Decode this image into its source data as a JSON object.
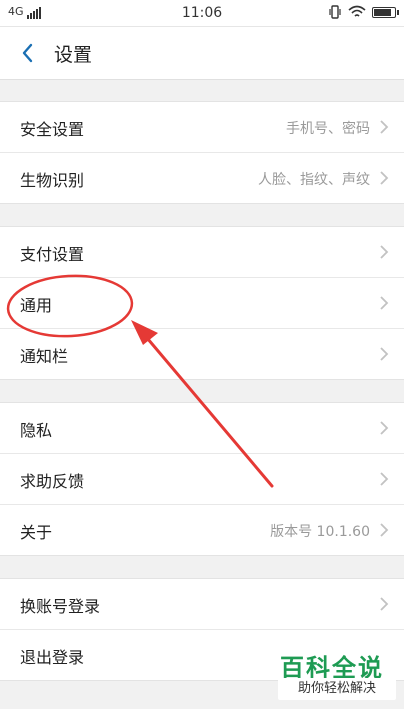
{
  "status_bar": {
    "network": "4G",
    "time": "11:06"
  },
  "header": {
    "title": "设置"
  },
  "groups": [
    {
      "items": [
        {
          "label": "安全设置",
          "value": "手机号、密码"
        },
        {
          "label": "生物识别",
          "value": "人脸、指纹、声纹"
        }
      ]
    },
    {
      "items": [
        {
          "label": "支付设置",
          "value": ""
        },
        {
          "label": "通用",
          "value": ""
        },
        {
          "label": "通知栏",
          "value": ""
        }
      ]
    },
    {
      "items": [
        {
          "label": "隐私",
          "value": ""
        },
        {
          "label": "求助反馈",
          "value": ""
        },
        {
          "label": "关于",
          "value": "版本号 10.1.60"
        }
      ]
    },
    {
      "items": [
        {
          "label": "换账号登录",
          "value": ""
        },
        {
          "label": "退出登录",
          "value": ""
        }
      ]
    }
  ],
  "watermark": {
    "title": "百科全说",
    "subtitle": "助你轻松解决"
  },
  "colors": {
    "accent": "#1a6fb3",
    "annotation": "#e53935",
    "watermark": "#1e9b53"
  }
}
